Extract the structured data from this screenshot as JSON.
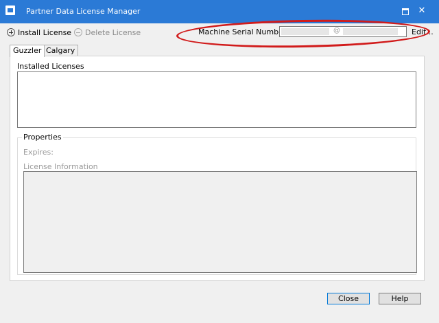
{
  "window": {
    "title": "Partner Data License Manager"
  },
  "toolbar": {
    "install_label": "Install License",
    "delete_label": "Delete License",
    "serial_label": "Machine Serial Number",
    "serial_at": "@",
    "edit_label": "Edit..."
  },
  "tabs": [
    "Guzzler",
    "Calgary"
  ],
  "panel": {
    "installed_label": "Installed Licenses",
    "properties_label": "Properties",
    "expires_label": "Expires:",
    "license_info_label": "License Information"
  },
  "buttons": {
    "close": "Close",
    "help": "Help"
  },
  "colors": {
    "titlebar": "#2b7ad6",
    "annotation": "#d11b1b"
  }
}
